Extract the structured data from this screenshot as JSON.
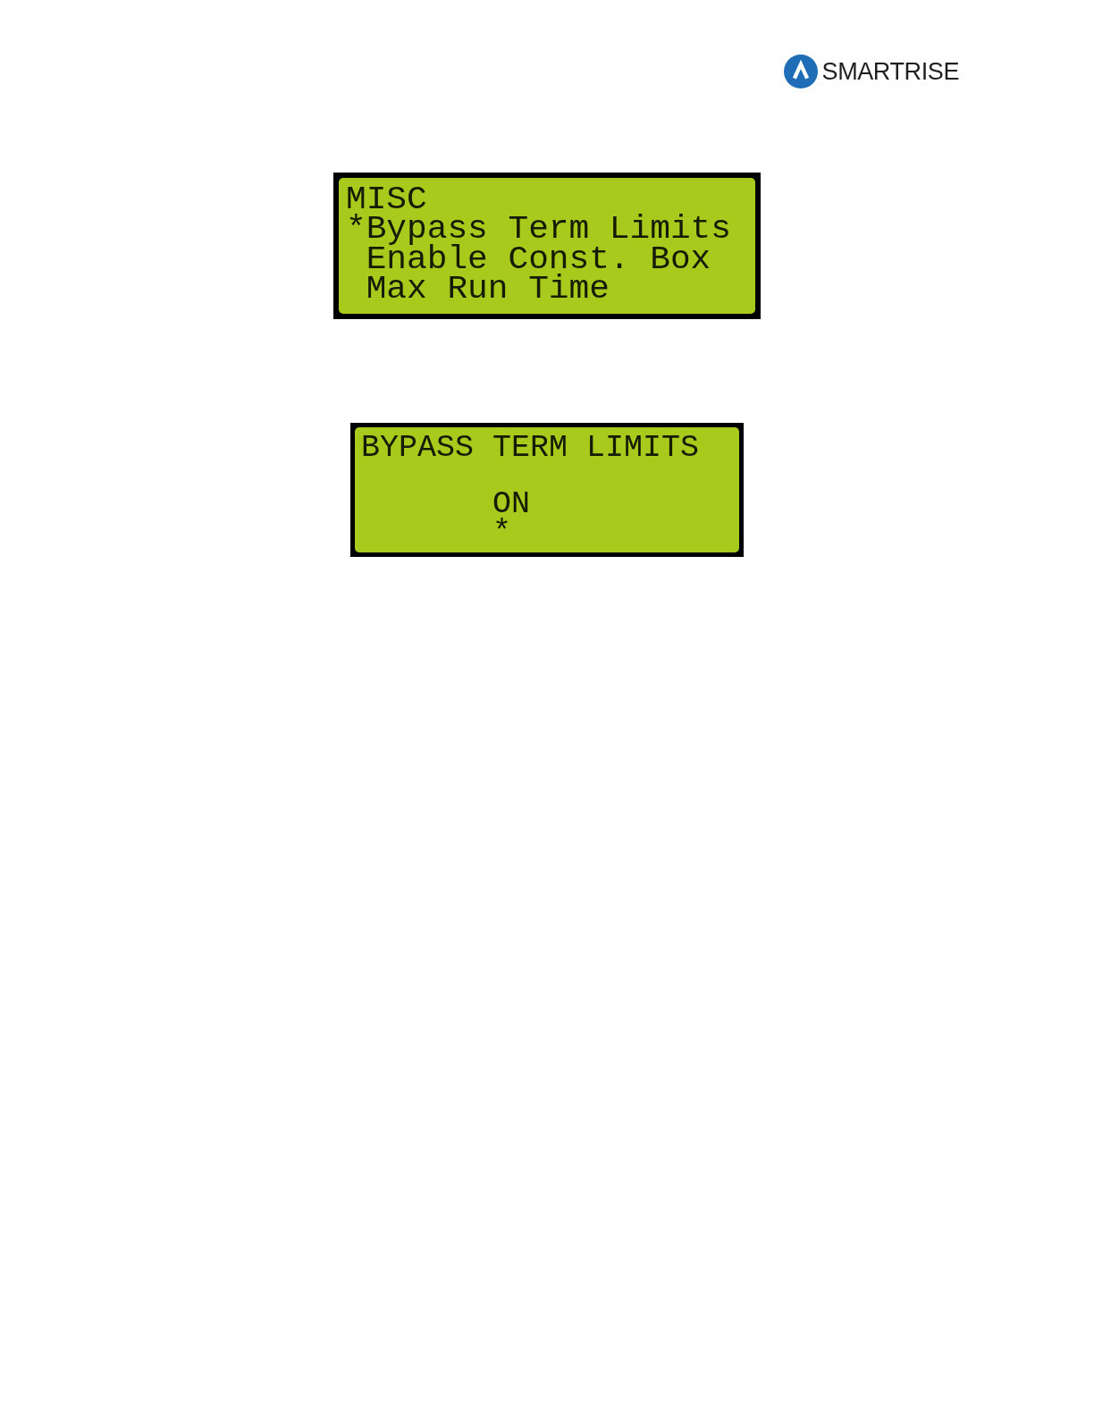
{
  "header": {
    "logo": {
      "wordmark": "SMARTRISE"
    }
  },
  "screens": [
    {
      "kind": "menu",
      "title": "MISC",
      "cursor": "*",
      "items": [
        {
          "label": "Bypass Term Limits",
          "selected": true
        },
        {
          "label": "Enable Const. Box",
          "selected": false
        },
        {
          "label": "Max Run Time",
          "selected": false
        }
      ]
    },
    {
      "kind": "setting",
      "title": "BYPASS TERM LIMITS",
      "value": "ON",
      "cursor": "*"
    }
  ]
}
